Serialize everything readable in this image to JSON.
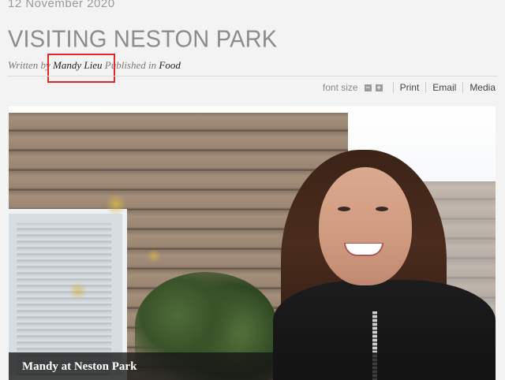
{
  "article": {
    "date": "12 November 2020",
    "title": "VISITING NESTON PARK",
    "byline": {
      "written_by": "Written by",
      "author": "Mandy Lieu",
      "published_in": "Published in",
      "category": "Food"
    }
  },
  "toolbar": {
    "font_size_label": "font size",
    "decrease_symbol": "−",
    "increase_symbol": "+",
    "print_label": "Print",
    "email_label": "Email",
    "media_label": "Media"
  },
  "image": {
    "caption": "Mandy at Neston Park"
  },
  "colors": {
    "highlight_box": "#e02a2a",
    "caption_bar": "#141414"
  }
}
